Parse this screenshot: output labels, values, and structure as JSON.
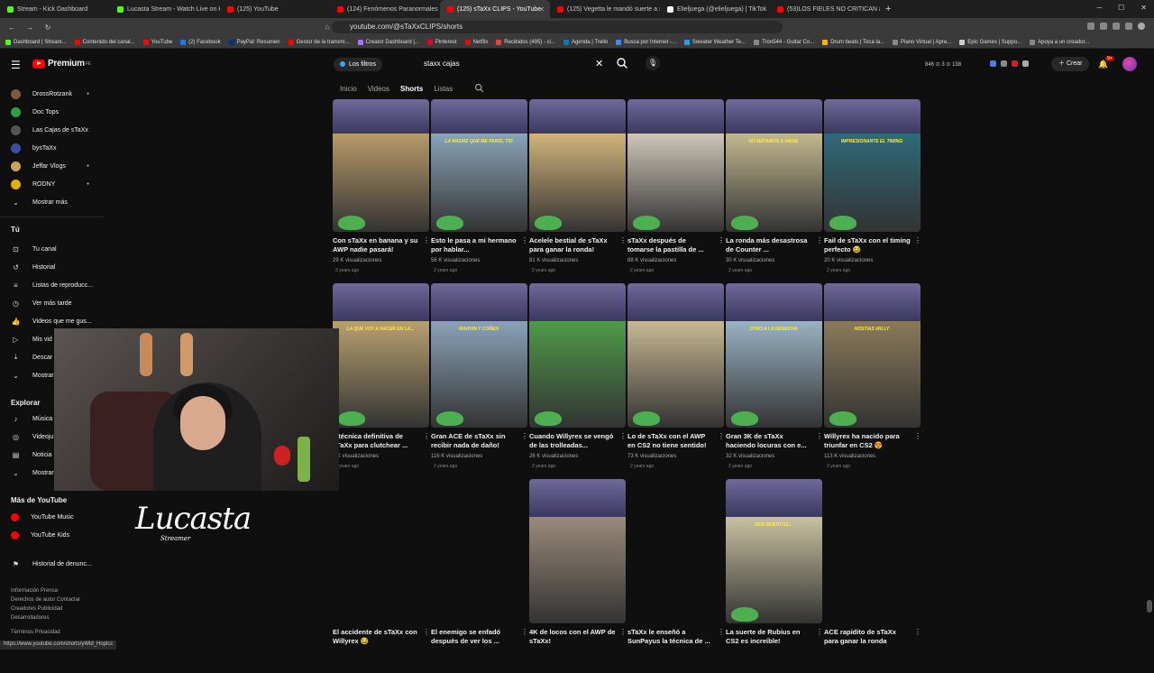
{
  "browser": {
    "tabs": [
      {
        "label": "Stream - Kick Dashboard",
        "color": "#53fc18"
      },
      {
        "label": "Lucasta Stream - Watch Live on Kick",
        "color": "#53fc18"
      },
      {
        "label": "(125) YouTube",
        "color": "#ff0000"
      },
      {
        "label": "(124) Fenómenos Paranormales Reales",
        "color": "#ff0000"
      },
      {
        "label": "(125) sTaXx CLIPS - YouTube",
        "color": "#ff0000",
        "active": true
      },
      {
        "label": "(125) Vegetta le mandó suerte a sTaXx",
        "color": "#ff0000"
      },
      {
        "label": "Elieljuega (@elieljuega) | TikTok",
        "color": "#ffffff"
      },
      {
        "label": "(53)LOS FIELES NO CRITICAN #elocos",
        "color": "#ff0000"
      }
    ],
    "url": "youtube.com/@sTaXxCLIPS/shorts",
    "bookmarks": [
      {
        "label": "Dashboard | Stream...",
        "color": "#53fc18"
      },
      {
        "label": "Contenido del canal...",
        "color": "#ff0000"
      },
      {
        "label": "YouTube",
        "color": "#ff0000"
      },
      {
        "label": "(2) Facebook",
        "color": "#1877f2"
      },
      {
        "label": "PayPal: Resumen",
        "color": "#003087"
      },
      {
        "label": "Gestor de la transmi...",
        "color": "#ff0000"
      },
      {
        "label": "Creator Dashboard |...",
        "color": "#a970ff"
      },
      {
        "label": "Pinterest",
        "color": "#e60023"
      },
      {
        "label": "Netflix",
        "color": "#e50914"
      },
      {
        "label": "Recibidos (495) - ci...",
        "color": "#ea4335"
      },
      {
        "label": "Agenda | Trello",
        "color": "#0079bf"
      },
      {
        "label": "Busca por Internet -...",
        "color": "#4285f4"
      },
      {
        "label": "Sweater Weather Te...",
        "color": "#1da1f2"
      },
      {
        "label": "Tron544 - Guitar Co...",
        "color": "#888888"
      },
      {
        "label": "Drum beats | Toca la...",
        "color": "#f4b400"
      },
      {
        "label": "Piano Virtual | Apre...",
        "color": "#888888"
      },
      {
        "label": "Epic Games | Suppo...",
        "color": "#cccccc"
      },
      {
        "label": "Apoya a un creador...",
        "color": "#888888"
      }
    ]
  },
  "header": {
    "logo": "Premium",
    "logo_region": "FE",
    "filters_label": "Los filtros",
    "search_value": "staxx cajas",
    "stats": "846  ⊙ 3  ⊙ 138",
    "create_label": "Crear",
    "bell_badge": "9+"
  },
  "channel_tabs": [
    {
      "label": "Inicio"
    },
    {
      "label": "Videos"
    },
    {
      "label": "Shorts",
      "selected": true
    },
    {
      "label": "Listas"
    }
  ],
  "sidebar": {
    "subscriptions": [
      {
        "label": "DrossRotzank",
        "color": "#7a5c3c"
      },
      {
        "label": "Doc Tops",
        "color": "#2ea043"
      },
      {
        "label": "Las Cajas de sTaXx",
        "color": "#555555"
      },
      {
        "label": "bysTaXx",
        "color": "#3a4fa0"
      },
      {
        "label": "Jeffar Vlogs",
        "color": "#c9a45a"
      },
      {
        "label": "RODNY",
        "color": "#e0b000"
      }
    ],
    "show_more": "Mostrar más",
    "you_header": "Tú",
    "you_items": [
      {
        "label": "Tu canal",
        "icon": "⊡"
      },
      {
        "label": "Historial",
        "icon": "↺"
      },
      {
        "label": "Listas de reproducc...",
        "icon": "≡"
      },
      {
        "label": "Ver más tarde",
        "icon": "◷"
      },
      {
        "label": "Videos que me gus...",
        "icon": "👍"
      },
      {
        "label": "Mis vid",
        "icon": "▷"
      },
      {
        "label": "Descar",
        "icon": "⤓"
      },
      {
        "label": "Mostrar",
        "icon": "⌄"
      }
    ],
    "explore_header": "Explorar",
    "explore_items": [
      {
        "label": "Música",
        "icon": "♪"
      },
      {
        "label": "Videoju",
        "icon": "◎"
      },
      {
        "label": "Noticia",
        "icon": "▤"
      },
      {
        "label": "Mostrar",
        "icon": "⌄"
      }
    ],
    "more_header": "Más de YouTube",
    "more_items": [
      {
        "label": "YouTube Music",
        "color": "#ff0000"
      },
      {
        "label": "YouTube Kids",
        "color": "#ff0000"
      }
    ],
    "report_history": "Historial de denunc...",
    "footer1": "Información  Prensa",
    "footer2": "Derechos de autor  Contactar",
    "footer3": "Creadores  Publicidad",
    "footer4": "Desarrolladores",
    "footer5": "Términos  Privacidad"
  },
  "shorts": [
    {
      "title": "Con sTaXx en banana y su AWP nadie pasará!",
      "views": "29 K visualizaciones",
      "age": "2 years ago",
      "bg": "#b89a6a",
      "overlay": ""
    },
    {
      "title": "Esto le pasa a mi hermano por hablar...",
      "views": "56 K visualizaciones",
      "age": "2 years ago",
      "bg": "#8aa4b8",
      "overlay": "LA MADRE QUE ME PARIO, TIO"
    },
    {
      "title": "Acelele bestial de sTaXx para ganar la ronda!",
      "views": "81 K visualizaciones",
      "age": "2 years ago",
      "bg": "#d2b47a",
      "overlay": ""
    },
    {
      "title": "sTaXx después de tomarse la pastilla de ...",
      "views": "88 K visualizaciones",
      "age": "2 years ago",
      "bg": "#cfc6b8",
      "overlay": ""
    },
    {
      "title": "La ronda más desastrosa de Counter ...",
      "views": "30 K visualizaciones",
      "age": "2 years ago",
      "bg": "#c2b890",
      "overlay": "NO MATAMOS A NADIE"
    },
    {
      "title": "Fail de sTaXx con el timing perfecto 😂",
      "views": "20 K visualizaciones",
      "age": "2 years ago",
      "bg": "#2f6a78",
      "overlay": "IMPRESIONANTE EL TIMING"
    },
    {
      "title": "...técnica definitiva de sTaXx para clutchear ...",
      "views": "...K visualizaciones",
      "age": "2 years ago",
      "bg": "#b8a070",
      "overlay": "LA QUE VOY A HACER EN LA..."
    },
    {
      "title": "Gran ACE de sTaXx sin recibir nada de daño!",
      "views": "116 K visualizaciones",
      "age": "2 years ago",
      "bg": "#8aa2b8",
      "overlay": "MARVIN Y COÑEN"
    },
    {
      "title": "Cuando Willyrex se vengó de las trolleadas...",
      "views": "26 K visualizaciones",
      "age": "2 years ago",
      "bg": "#4f9a4a",
      "overlay": ""
    },
    {
      "title": "Lo de sTaXx con el AWP en CS2 no tiene sentido!",
      "views": "73 K visualizaciones",
      "age": "2 years ago",
      "bg": "#c8b894",
      "overlay": ""
    },
    {
      "title": "Gran 3K de sTaXx haciendo locuras con e...",
      "views": "32 K visualizaciones",
      "age": "2 years ago",
      "bg": "#9ab2c4",
      "overlay": "OTRO A LA DERECHA"
    },
    {
      "title": "Willyrex ha nacido para triunfar en CS2 😍",
      "views": "113 K visualizaciones",
      "age": "2 years ago",
      "bg": "#8a7a5a",
      "overlay": "HOSTIAS WILLY"
    },
    {
      "title": "El accidente de sTaXx con Willyrex 😂",
      "views": "",
      "age": "",
      "bg": "",
      "overlay": ""
    },
    {
      "title": "El enemigo se enfadó después de ver los ...",
      "views": "",
      "age": "",
      "bg": "",
      "overlay": ""
    },
    {
      "title": "4K de locos con el AWP de sTaXx!",
      "views": "",
      "age": "",
      "bg": "#9a8a7a",
      "overlay": ""
    },
    {
      "title": "sTaXx le enseñó a SunPayus la técnica de ...",
      "views": "",
      "age": "",
      "bg": "",
      "overlay": ""
    },
    {
      "title": "La suerte de Rubius en CS2 es increíble!",
      "views": "",
      "age": "",
      "bg": "#c8c0a0",
      "overlay": "DOS MUERTOS..."
    },
    {
      "title": "ACE rapidito de sTaXx para ganar la ronda",
      "views": "",
      "age": "",
      "bg": "",
      "overlay": ""
    }
  ],
  "watermark": {
    "name": "Lucasta",
    "sub": "Streamer"
  },
  "status_url": "https://www.youtube.com/shorts/yWld_Hoplcc"
}
